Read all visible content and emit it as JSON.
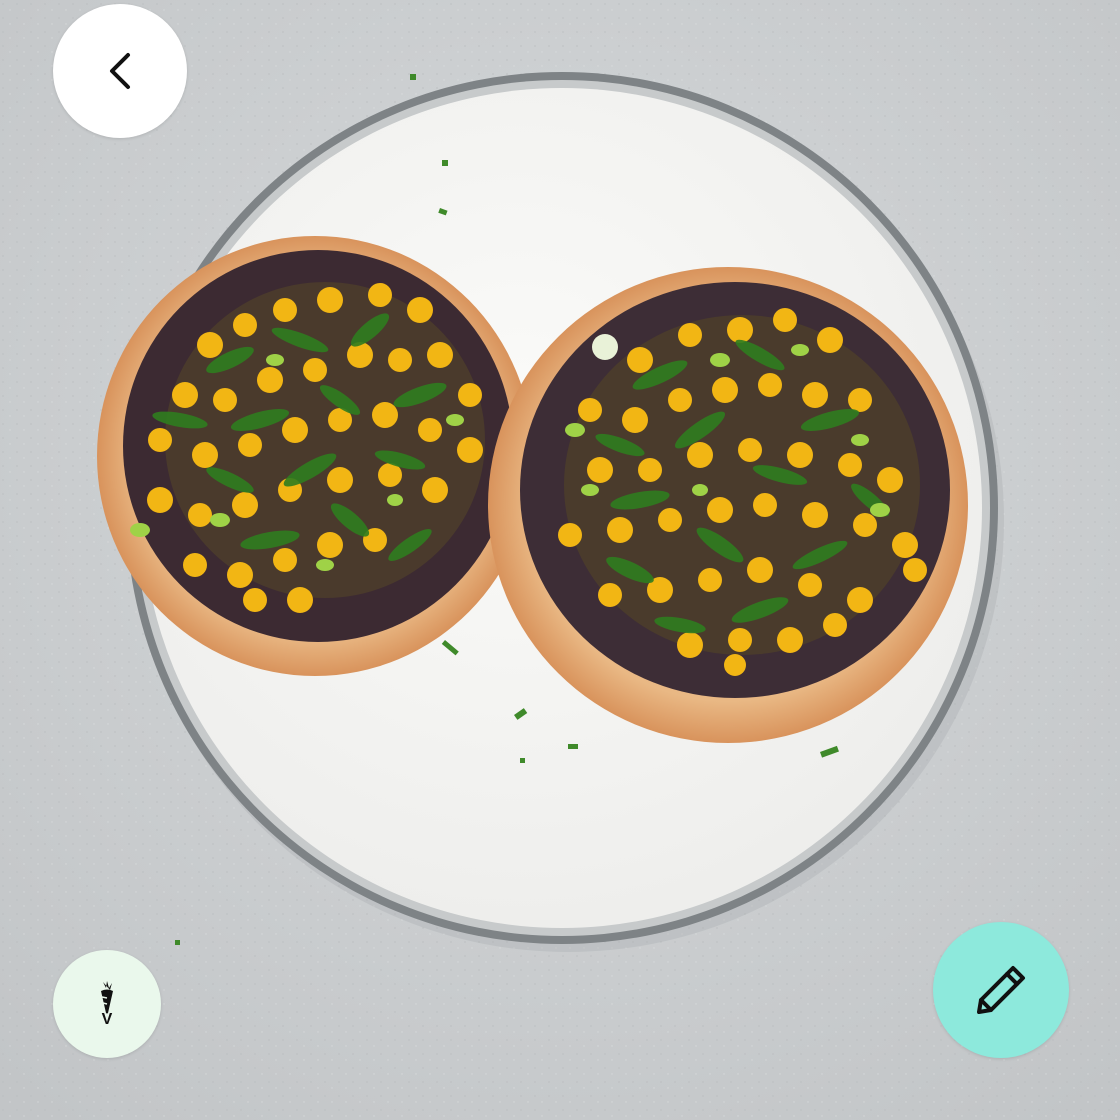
{
  "photo": {
    "icon": "tostadas-food-photo"
  },
  "back_button": {
    "icon": "chevron-left-icon"
  },
  "diet_badge": {
    "icon": "carrot-icon",
    "label": "V",
    "color": "#eaf8ec"
  },
  "edit_button": {
    "icon": "pencil-icon",
    "color": "#8de9dc"
  }
}
